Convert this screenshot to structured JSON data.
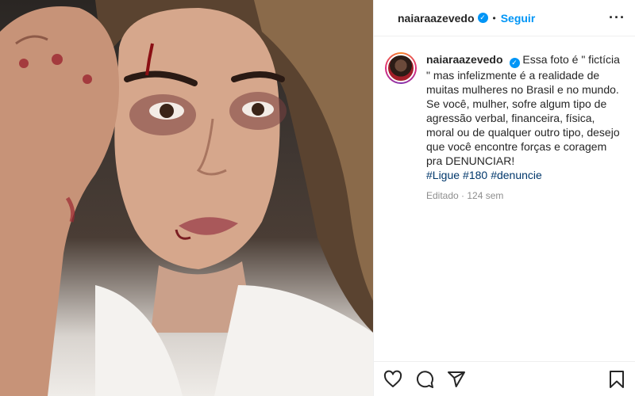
{
  "post": {
    "image_alt": "Selfie de mulher com maquiagem de hematomas e ferimentos",
    "header": {
      "username": "naiaraazevedo",
      "dot": "•",
      "follow_label": "Seguir",
      "more_icon": "more-horizontal-icon"
    },
    "caption": {
      "username": "naiaraazevedo",
      "line1": "Essa foto é \" fictícia \" mas infelizmente é a realidade de muitas mulheres no Brasil e no mundo.",
      "line2": "Se você, mulher, sofre algum tipo de agressão verbal, financeira, física, moral ou de qualquer outro tipo, desejo que você encontre forças e coragem pra DENUNCIAR!",
      "hashtags": [
        "#Ligue",
        "#180",
        "#denuncie"
      ],
      "edited_label": "Editado",
      "time_ago": "124 sem"
    },
    "actions": {
      "like_icon": "heart-icon",
      "comment_icon": "comment-icon",
      "share_icon": "share-icon",
      "save_icon": "bookmark-icon"
    },
    "colors": {
      "link_blue": "#0095f6",
      "hashtag_blue": "#00376b",
      "muted_text": "#8e8e8e"
    }
  }
}
